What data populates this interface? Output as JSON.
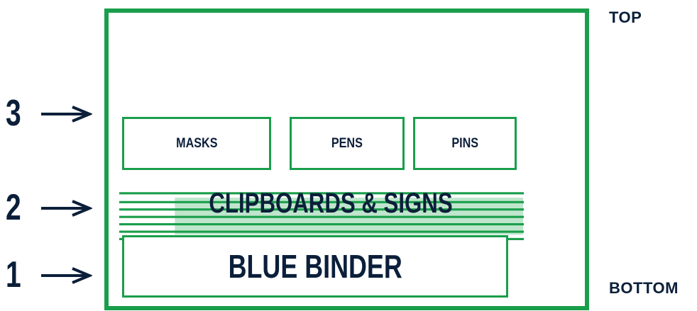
{
  "labels": {
    "top": "TOP",
    "bottom": "BOTTOM"
  },
  "layers": {
    "layer3": "3",
    "layer2": "2",
    "layer1": "1"
  },
  "items": {
    "masks": "MASKS",
    "pens": "PENS",
    "pins": "PINS",
    "clipboards": "CLIPBOARDS & SIGNS",
    "binder": "BLUE BINDER"
  },
  "colors": {
    "accent": "#1a9e4b",
    "stripe_light": "#bfe6cc",
    "text": "#0b1f3a"
  }
}
